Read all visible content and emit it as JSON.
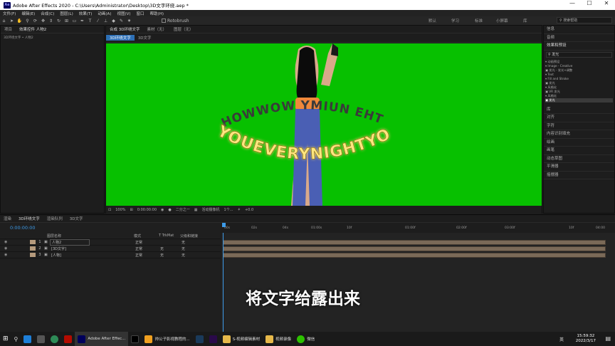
{
  "window": {
    "app_badge": "Ae",
    "title": "Adobe After Effects 2020 - C:\\Users\\Administrator\\Desktop\\3D文字环绕.aep *",
    "min": "—",
    "max": "☐",
    "close": "✕"
  },
  "menu": [
    "文件(F)",
    "编辑(E)",
    "合成(C)",
    "图层(L)",
    "效果(T)",
    "动画(A)",
    "视图(V)",
    "窗口",
    "帮助(H)"
  ],
  "toolbar": {
    "rotobrush": "Rotobrush",
    "workspaces": [
      "默认",
      "学习",
      "标准",
      "小屏幕",
      "库"
    ],
    "search_placeholder": "搜索帮助"
  },
  "effects_panel": {
    "tabs": [
      "项目",
      "效果控件 人物2"
    ],
    "sub": "3D环绕文字 • 人物2"
  },
  "comp_panel": {
    "tabs": [
      "合成 3D环绕文字",
      "素材（无）",
      "图层（无）"
    ],
    "subtabs": [
      "3D环绕文字",
      "3D文字"
    ],
    "ring_text": "YOUEVERYNIGHTYO",
    "ring_text_back": "HOWWOW YMIUN EHT",
    "bottom": [
      "100%",
      "0:00:00:00",
      "二分之一",
      "活动摄像机",
      "1个...",
      "+0.0"
    ]
  },
  "right_panel": {
    "items_top": [
      "信息",
      "音频",
      "效果和预设"
    ],
    "search": "发光",
    "tree": [
      "▾ 动画预设",
      "  ▾ Image - Creative",
      "     ▣ 发光 - 发光+调整",
      "  ▾ Text",
      "    ▾ Fill and Stroke",
      "       ▣ 发光",
      "▾ 风格化",
      "   ▣ VR 发光",
      "▾ 风格化",
      "   ▣ 发光"
    ],
    "items_bottom": [
      "库",
      "对齐",
      "字符",
      "内容识别填充",
      "绘画",
      "画笔",
      "动态草图",
      "平滑器",
      "摇摆器"
    ]
  },
  "timeline": {
    "tabs": [
      "渲染",
      "3D环绕文字",
      "渲染队列",
      "3D文字"
    ],
    "timecode": "0:00:00:00",
    "headers": [
      "图层名称",
      "模式",
      "T TrkMat",
      "父级和链接"
    ],
    "layers": [
      {
        "num": "1",
        "name": "人物2",
        "mode": "正常",
        "trk": "",
        "parent": "无"
      },
      {
        "num": "2",
        "name": "[3D文字]",
        "mode": "正常",
        "trk": "无",
        "parent": "无"
      },
      {
        "num": "3",
        "name": "[人物]",
        "mode": "正常",
        "trk": "无",
        "parent": "无"
      }
    ],
    "ruler": [
      "00s",
      "02s",
      "04s",
      "01:00s",
      "10f",
      "01:00f",
      "02:00f",
      "03:00f",
      "10f",
      "04:00"
    ]
  },
  "subtitle": "将文字给露出来",
  "taskbar": {
    "apps": [
      "Adobe After Effec...",
      "帅公子影视教程的...",
      "S-视频编辑素材",
      "视频录像",
      "微信"
    ],
    "time": "15:59:32",
    "date": "2022/3/17",
    "lang": "英"
  }
}
